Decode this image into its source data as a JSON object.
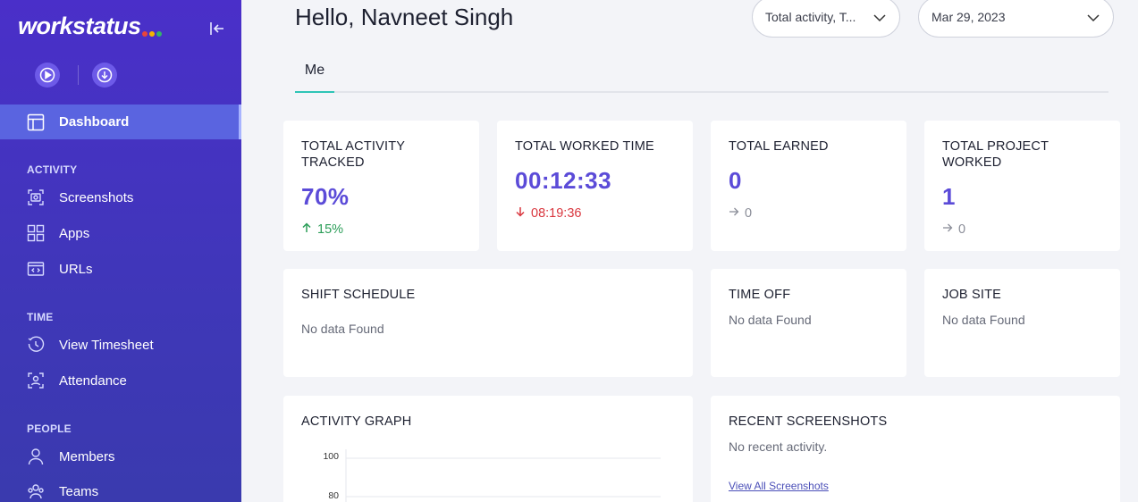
{
  "brand": {
    "name": "workstatus",
    "dot_colors": [
      "#e8453c",
      "#f5b400",
      "#34b36b"
    ]
  },
  "sidebar": {
    "active": {
      "label": "Dashboard"
    },
    "sections": [
      {
        "label": "ACTIVITY",
        "items": [
          {
            "label": "Screenshots"
          },
          {
            "label": "Apps"
          },
          {
            "label": "URLs"
          }
        ]
      },
      {
        "label": "TIME",
        "items": [
          {
            "label": "View Timesheet"
          },
          {
            "label": "Attendance"
          }
        ]
      },
      {
        "label": "PEOPLE",
        "items": [
          {
            "label": "Members"
          },
          {
            "label": "Teams"
          }
        ]
      }
    ]
  },
  "header": {
    "greeting": "Hello, Navneet Singh",
    "filter_value": "Total activity, T...",
    "date_value": "Mar 29, 2023"
  },
  "tabs": [
    {
      "label": "Me"
    }
  ],
  "stats": [
    {
      "title": "TOTAL ACTIVITY TRACKED",
      "value": "70%",
      "delta": "15%",
      "delta_dir": "up"
    },
    {
      "title": "TOTAL WORKED TIME",
      "value": "00:12:33",
      "delta": "08:19:36",
      "delta_dir": "down"
    },
    {
      "title": "TOTAL EARNED",
      "value": "0",
      "delta": "0",
      "delta_dir": "flat"
    },
    {
      "title": "TOTAL PROJECT WORKED",
      "value": "1",
      "delta": "0",
      "delta_dir": "flat"
    }
  ],
  "panels": {
    "shift_schedule": {
      "title": "SHIFT SCHEDULE",
      "empty": "No data Found"
    },
    "time_off": {
      "title": "TIME OFF",
      "empty": "No data Found"
    },
    "job_site": {
      "title": "JOB SITE",
      "empty": "No data Found"
    },
    "activity_graph": {
      "title": "ACTIVITY GRAPH",
      "ticks": [
        "100",
        "80"
      ]
    },
    "recent_screenshots": {
      "title": "RECENT SCREENSHOTS",
      "empty": "No recent activity.",
      "link": "View All Screenshots"
    }
  },
  "colors": {
    "accent": "#5b4bd8",
    "up": "#2a9d57",
    "down": "#d9363e",
    "tab_underline": "#2ec4b6"
  }
}
